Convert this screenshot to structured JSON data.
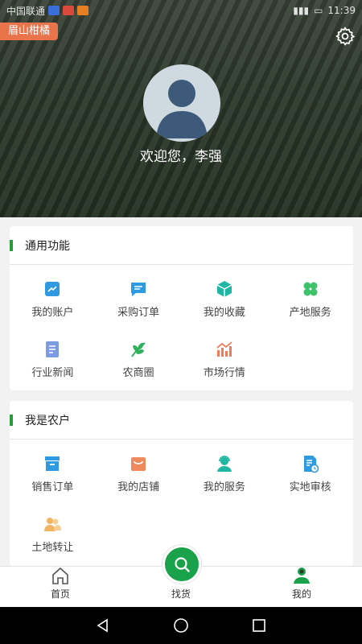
{
  "status_bar": {
    "carrier": "中国联通",
    "time": "11:39"
  },
  "header": {
    "tag": "眉山柑橘",
    "welcome": "欢迎您，李强"
  },
  "general_section": {
    "title": "通用功能",
    "items": [
      {
        "label": "我的账户",
        "icon": "account-icon",
        "color": "#2f9ae0"
      },
      {
        "label": "采购订单",
        "icon": "order-icon",
        "color": "#2f9ae0"
      },
      {
        "label": "我的收藏",
        "icon": "collection-icon",
        "color": "#1fb7a3"
      },
      {
        "label": "产地服务",
        "icon": "clover-icon",
        "color": "#3ec26b"
      },
      {
        "label": "行业新闻",
        "icon": "news-icon",
        "color": "#7d9be3"
      },
      {
        "label": "农商圈",
        "icon": "leaf-icon",
        "color": "#2cb05a"
      },
      {
        "label": "市场行情",
        "icon": "market-chart-icon",
        "color": "#f07b5a"
      }
    ]
  },
  "farmer_section": {
    "title": "我是农户",
    "items": [
      {
        "label": "销售订单",
        "icon": "sales-box-icon",
        "color": "#2f9ae0"
      },
      {
        "label": "我的店铺",
        "icon": "shop-icon",
        "color": "#f08a5d"
      },
      {
        "label": "我的服务",
        "icon": "service-icon",
        "color": "#1fb7a3"
      },
      {
        "label": "实地审核",
        "icon": "audit-icon",
        "color": "#2f9ae0"
      },
      {
        "label": "土地转让",
        "icon": "land-transfer-icon",
        "color": "#f2b463"
      }
    ]
  },
  "bottom_nav": {
    "home": "首页",
    "find": "找货",
    "mine": "我的",
    "accent": "#1aa24a"
  }
}
